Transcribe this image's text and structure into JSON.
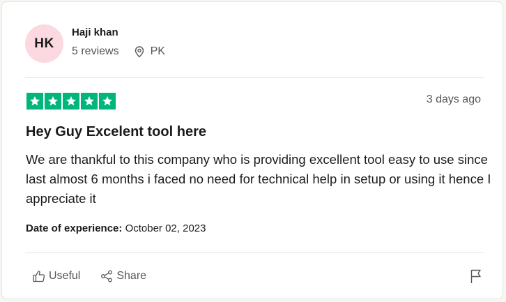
{
  "reviewer": {
    "initials": "HK",
    "name": "Haji khan",
    "reviews_count": "5 reviews",
    "location": "PK",
    "avatar_color": "#fcd9e1"
  },
  "rating": {
    "stars": 5,
    "max_stars": 5,
    "star_color": "#00b67a"
  },
  "review": {
    "date_ago": "3 days ago",
    "title": "Hey Guy Excelent tool here",
    "body": "We are thankful to this company who is providing excellent tool easy to use since last almost 6 months i faced no need for technical help in setup or using it hence I appreciate it",
    "experience_label": "Date of experience:",
    "experience_date": "October 02, 2023"
  },
  "actions": {
    "useful_label": "Useful",
    "share_label": "Share",
    "useful_icon": "thumbs-up-icon",
    "share_icon": "share-icon",
    "flag_icon": "flag-icon"
  }
}
